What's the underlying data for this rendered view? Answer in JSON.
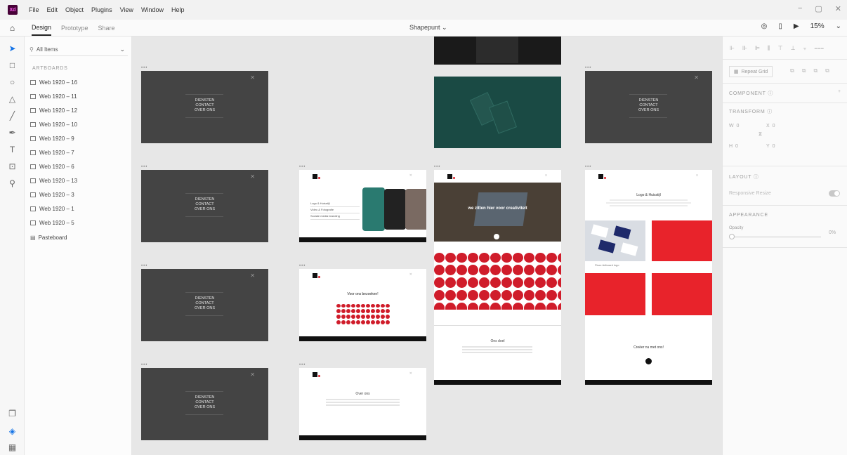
{
  "app": {
    "logo": "Xd",
    "menus": [
      "File",
      "Edit",
      "Object",
      "Plugins",
      "View",
      "Window",
      "Help"
    ],
    "window_controls": [
      "−",
      "▢",
      "✕"
    ]
  },
  "toolbar": {
    "tabs": [
      "Design",
      "Prototype",
      "Share"
    ],
    "document_title": "Shapepunt ⌄",
    "zoom": "15%"
  },
  "layers": {
    "search_placeholder": "All Items",
    "section_label": "ARTBOARDS",
    "items": [
      "Web 1920 – 16",
      "Web 1920 – 11",
      "Web 1920 – 12",
      "Web 1920 – 10",
      "Web 1920 – 9",
      "Web 1920 – 7",
      "Web 1920 – 6",
      "Web 1920 – 13",
      "Web 1920 – 3",
      "Web 1920 – 1",
      "Web 1920 – 5"
    ],
    "pasteboard": "Pasteboard"
  },
  "canvas": {
    "menu_text": [
      "DIENSTEN",
      "CONTACT",
      "OVER ONS"
    ],
    "services": [
      "Logo & Huisstijl",
      "Video & Fotografie",
      "Sociale media branding"
    ],
    "hero_text": "we zitten hier voor creativiteit",
    "contact_title": "Voor ons bezoeken!",
    "about_title": "Over ons",
    "goal_title": "Ons doel",
    "logo_title": "Logo & Huisstijl",
    "logo_caption": "Fluxx Artboard logo",
    "cta_title": "Creëer nu met ons!"
  },
  "properties": {
    "repeat_grid": "Repeat Grid",
    "component": "COMPONENT",
    "transform": "TRANSFORM",
    "w_label": "W",
    "w_value": "0",
    "x_label": "X",
    "x_value": "0",
    "h_label": "H",
    "h_value": "0",
    "y_label": "Y",
    "y_value": "0",
    "layout": "LAYOUT",
    "responsive_resize": "Responsive Resize",
    "appearance": "APPEARANCE",
    "opacity_label": "Opacity",
    "opacity_value": "0%"
  },
  "colors": {
    "accent_red": "#e8232b",
    "dark_artboard": "#444444",
    "teal": "#1a4a44"
  }
}
